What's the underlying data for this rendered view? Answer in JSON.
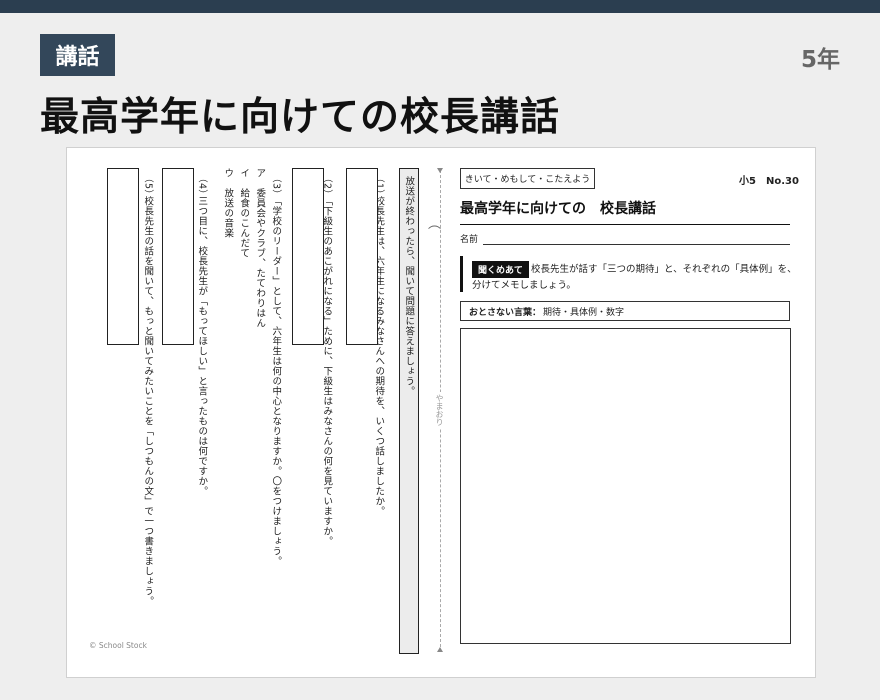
{
  "header": {
    "tag": "講話",
    "grade": "5年",
    "title": "最高学年に向けての校長講話"
  },
  "worksheet": {
    "instruction": "放送が終わったら、聞いて問題に答えましょう。",
    "fold_label": "やまおり",
    "copyright": "© School Stock",
    "questions": [
      {
        "number": "（1）",
        "text": "校長先生は、六年生になるみなさんへの期待を、いくつ話しましたか。"
      },
      {
        "number": "（2）",
        "text": "「下級生のあこがれになる」ために、下級生はみなさんの何を見ていますか。"
      },
      {
        "number": "（3）",
        "text": "「学校のリーダー」として、六年生は何の中心となりますか。〇をつけましょう。",
        "options": [
          "ア　委員会やクラブ、たてわりはん",
          "イ　給食のこんだて",
          "ウ　放送の音楽"
        ]
      },
      {
        "number": "（4）",
        "text": "三つ目に、校長先生が「もってほしい」と言ったものは何ですか。"
      },
      {
        "number": "（5）",
        "text": "校長先生の話を聞いて、もっと聞いてみたいことを「しつもんの文」で一つ書きましょう。"
      }
    ],
    "right_panel": {
      "tag": "きいて・めもして・こたえよう",
      "grade_no": "小5　No.30",
      "title": "最高学年に向けての　校長講話",
      "name_label": "名前",
      "goal_label": "聞くめあて",
      "goal_text_1": "校長先生が話す「三つの期待」と、それぞれの「具体例」を、",
      "goal_text_2": "分けてメモしましょう。",
      "words_label": "おとさない言葉：",
      "words_text": "期待・具体例・数字"
    }
  }
}
